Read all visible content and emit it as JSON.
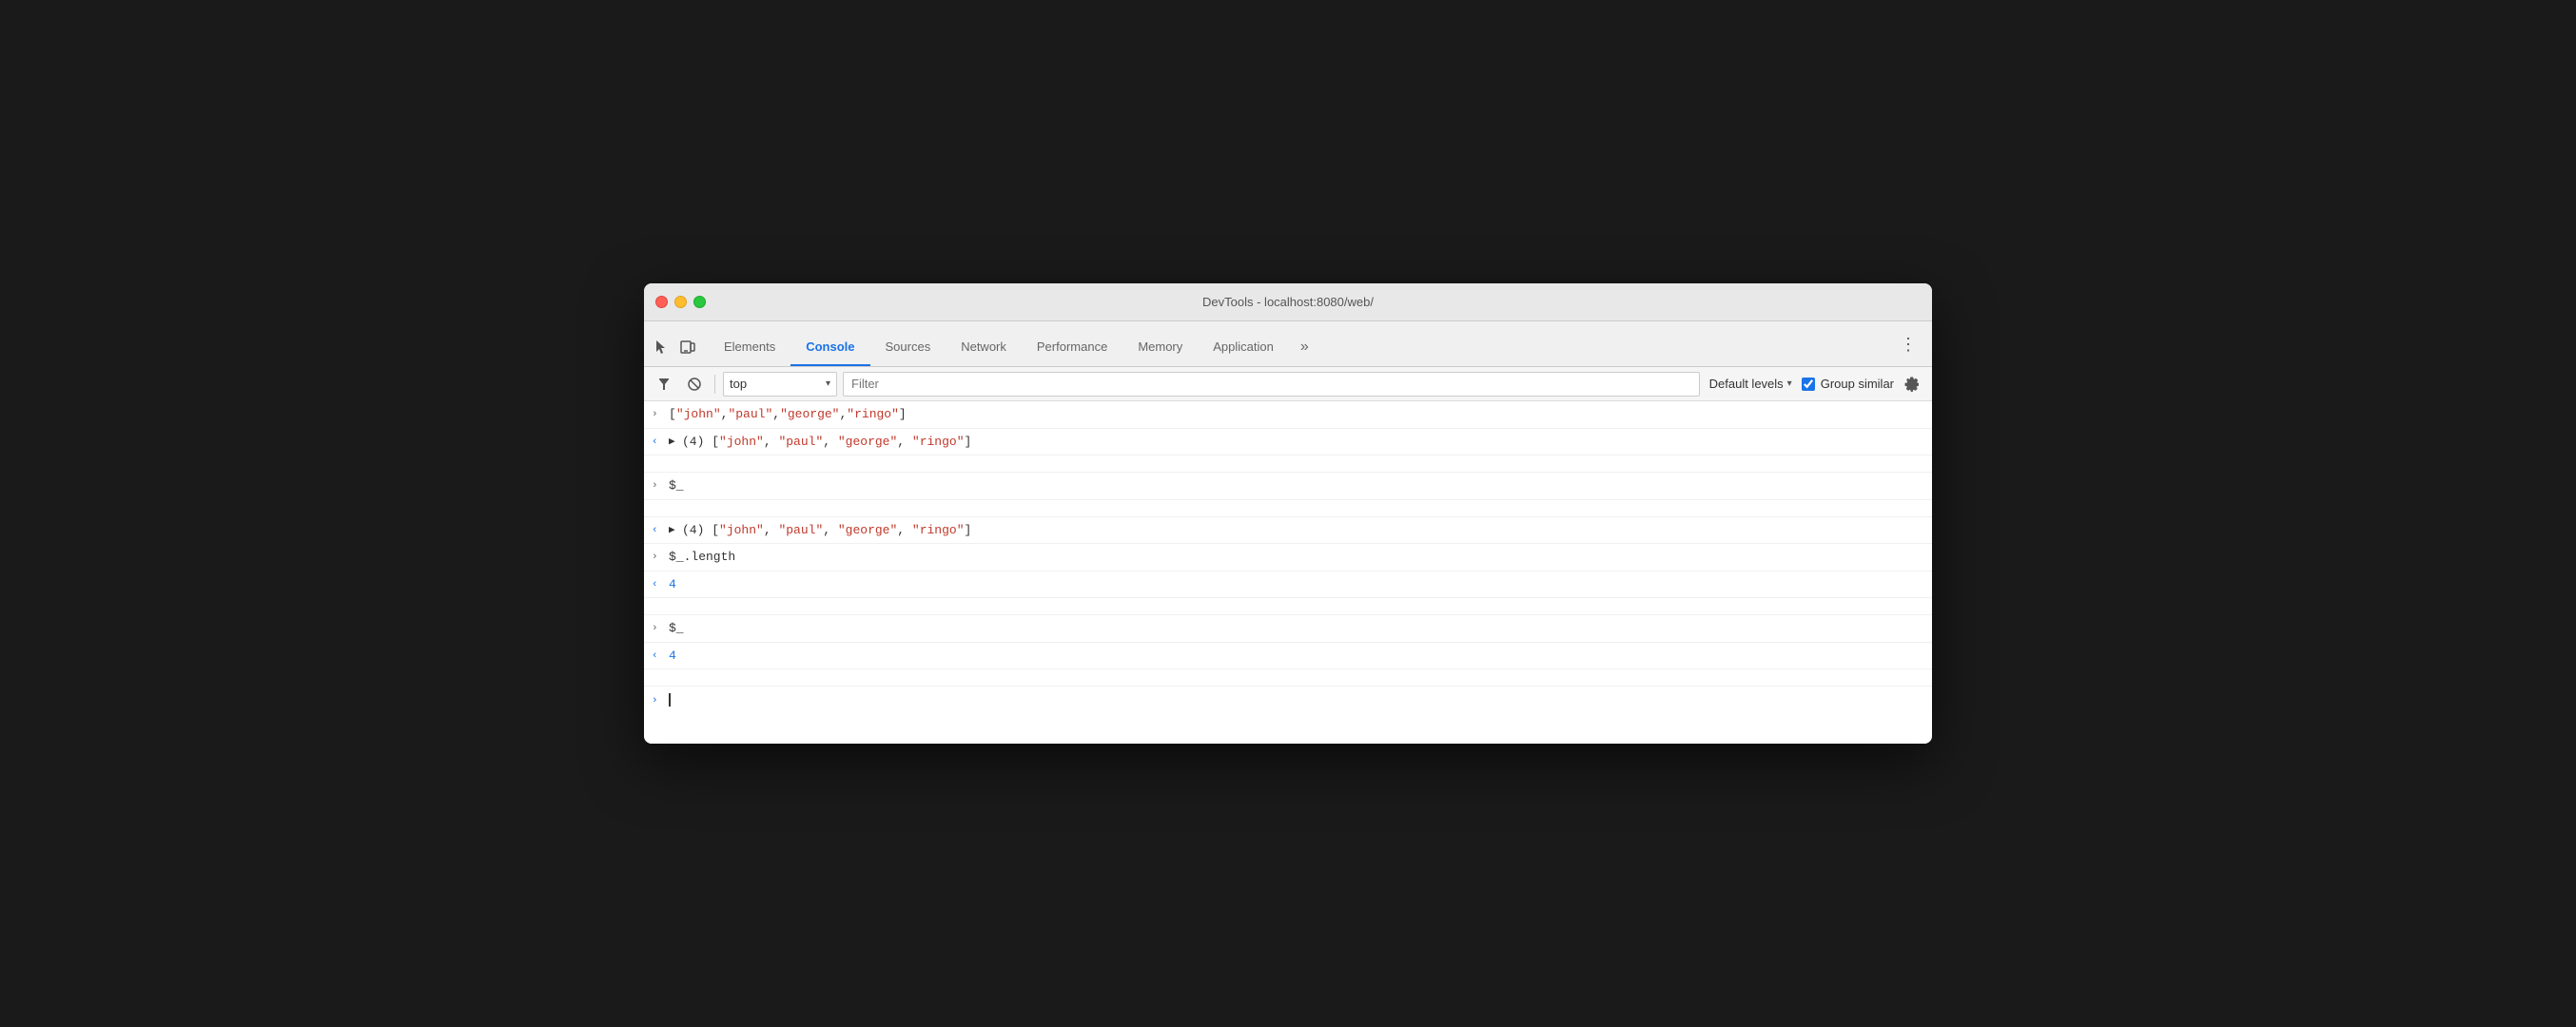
{
  "window": {
    "title": "DevTools - localhost:8080/web/"
  },
  "traffic_lights": {
    "red_label": "close",
    "yellow_label": "minimize",
    "green_label": "maximize"
  },
  "tabs": [
    {
      "id": "elements",
      "label": "Elements",
      "active": false
    },
    {
      "id": "console",
      "label": "Console",
      "active": true
    },
    {
      "id": "sources",
      "label": "Sources",
      "active": false
    },
    {
      "id": "network",
      "label": "Network",
      "active": false
    },
    {
      "id": "performance",
      "label": "Performance",
      "active": false
    },
    {
      "id": "memory",
      "label": "Memory",
      "active": false
    },
    {
      "id": "application",
      "label": "Application",
      "active": false
    }
  ],
  "tabs_more_label": "»",
  "toolbar": {
    "context_value": "top",
    "context_dropdown_symbol": "▾",
    "filter_placeholder": "Filter",
    "default_levels_label": "Default levels",
    "default_levels_arrow": "▾",
    "group_similar_label": "Group similar",
    "group_similar_checked": true
  },
  "console_rows": [
    {
      "type": "input",
      "arrow": "›",
      "content_plain": "[\"john\",\"paul\",\"george\",\"ringo\"]"
    },
    {
      "type": "output_expandable",
      "arrow": "‹",
      "expanded": false,
      "expand_arrow": "▶",
      "content": "(4) [\"john\", \"paul\", \"george\", \"ringo\"]"
    },
    {
      "type": "empty"
    },
    {
      "type": "input",
      "arrow": "›",
      "content_plain": "$_"
    },
    {
      "type": "empty"
    },
    {
      "type": "output_expandable",
      "arrow": "‹",
      "expanded": false,
      "expand_arrow": "▶",
      "content": "(4) [\"john\", \"paul\", \"george\", \"ringo\"]"
    },
    {
      "type": "input",
      "arrow": "›",
      "content_plain": "$_.length"
    },
    {
      "type": "output_number",
      "arrow": "‹",
      "value": "4"
    },
    {
      "type": "empty"
    },
    {
      "type": "input",
      "arrow": "›",
      "content_plain": "$_"
    },
    {
      "type": "output_number",
      "arrow": "‹",
      "value": "4"
    },
    {
      "type": "empty"
    }
  ],
  "console_input": {
    "arrow": "›",
    "cursor": "|"
  }
}
